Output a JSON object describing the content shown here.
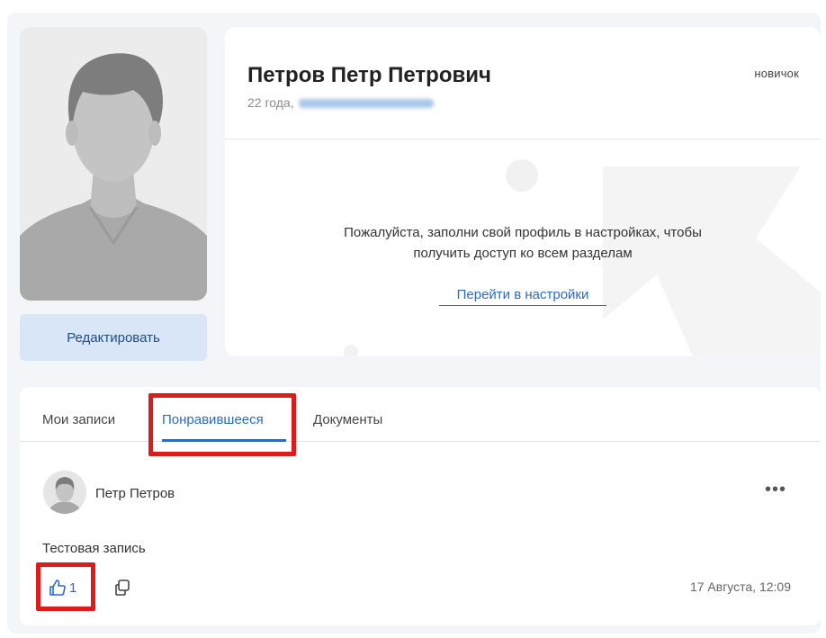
{
  "profile": {
    "name": "Петров Петр Петрович",
    "age": "22 года,",
    "status": "новичок",
    "edit_label": "Редактировать"
  },
  "notice": {
    "line1": "Пожалуйста, заполни свой профиль в настройках, чтобы",
    "line2": "получить доступ ко всем разделам",
    "link_label": "Перейти в настройки"
  },
  "tabs": [
    {
      "label": "Мои записи",
      "active": false
    },
    {
      "label": "Понравившееся",
      "active": true
    },
    {
      "label": "Документы",
      "active": false
    }
  ],
  "post": {
    "author": "Петр Петров",
    "text": "Тестовая запись",
    "likes": "1",
    "date": "17 Августа, 12:09",
    "menu_label": "•••"
  },
  "colors": {
    "accent": "#2a6bc6",
    "highlight": "#dd1b1b",
    "edit_button_bg": "#d8e6f7"
  },
  "icons": [
    "user-avatar-placeholder-icon",
    "thumbs-up-icon",
    "copy-icon",
    "more-dots-icon"
  ]
}
